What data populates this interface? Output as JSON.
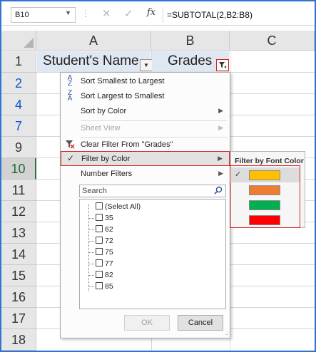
{
  "formula_bar": {
    "name_box": "B10",
    "fx": "fx",
    "formula": "=SUBTOTAL(2,B2:B8)"
  },
  "columns": [
    "A",
    "B",
    "C"
  ],
  "rows": [
    "1",
    "2",
    "4",
    "7",
    "9",
    "10",
    "11",
    "12",
    "13",
    "14",
    "15",
    "16",
    "17",
    "18"
  ],
  "headers": {
    "a1": "Student's Name",
    "b1": "Grades"
  },
  "menu": {
    "sort_asc": "Sort Smallest to Largest",
    "sort_desc": "Sort Largest to Smallest",
    "sort_color": "Sort by Color",
    "sheet_view": "Sheet View",
    "clear_filter": "Clear Filter From \"Grades\"",
    "filter_color": "Filter by Color",
    "number_filters": "Number Filters",
    "search_placeholder": "Search",
    "list_items": [
      "(Select All)",
      "35",
      "62",
      "72",
      "75",
      "77",
      "82",
      "85"
    ],
    "ok": "OK",
    "cancel": "Cancel"
  },
  "submenu": {
    "title": "Filter by Font Color",
    "colors": [
      "#ffc000",
      "#ed7d31",
      "#00b050",
      "#ff0000"
    ],
    "selected_index": 0
  },
  "colors": {
    "frame": "#2e74d0",
    "highlight_border": "#d62222",
    "header_fill": "#dfe7f2"
  }
}
